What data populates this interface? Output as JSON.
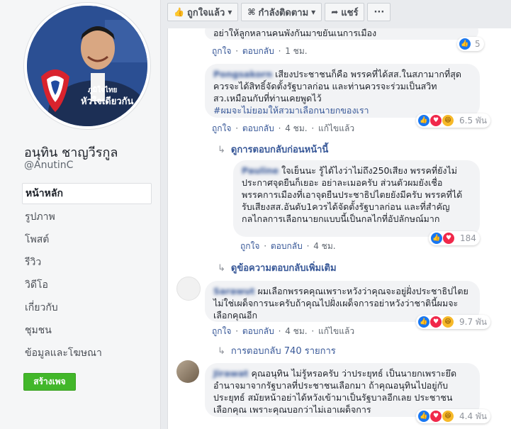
{
  "sidebar": {
    "page_name": "อนุทิน ชาญวีรกูล",
    "handle": "@AnutinC",
    "nav": [
      "หน้าหลัก",
      "รูปภาพ",
      "โพสต์",
      "รีวิว",
      "วิดีโอ",
      "เกี่ยวกับ",
      "ชุมชน",
      "ข้อมูลและโฆษณา"
    ],
    "create_page": "สร้างเพจ",
    "avatar_slogan_1": "ภูมิใจไทย",
    "avatar_slogan_2": "หัวใจเดียวกัน"
  },
  "toolbar": {
    "liked": "ถูกใจแล้ว",
    "following": "กำลังติดตาม",
    "share": "แชร์",
    "more": "···"
  },
  "comments": [
    {
      "text": "อย่าให้ลูกหลานคนพังกันมาขยันเนการเมือง",
      "like": "ถูกใจ",
      "reply": "ตอบกลับ",
      "time": "1 ชม.",
      "count": "5"
    },
    {
      "author": "Pongsakorn",
      "text": "เสียงประชาชนก็คือ พรรคที่ได้สส.ในสภามากที่สุดควรจะได้สิทธิ์จัดตั้งรัฐบาลก่อน และท่านควรจะร่วมเป็นสวิท สว.เหมือนกับที่ท่านเคยพูดไว้",
      "hashtag": "#ผมจะไม่ยอมให้สวมาเลือกนายกของเรา",
      "like": "ถูกใจ",
      "reply": "ตอบกลับ",
      "time": "4 ชม.",
      "edited": "แก้ไขแล้ว",
      "count": "6.5 พัน"
    }
  ],
  "reply_prev": "ดูการตอบกลับก่อนหน้านี้",
  "reply_comment": {
    "author": "Pauline",
    "text": "ใจเย็นนะ รู้ได้ไงว่าไม่ถึง250เสียง พรรคที่ยังไม่ประกาศจุดยืนก็เยอะ อย่าละเมอครับ ส่วนตัวผมยังเชื่อพรรคการเมืองที่เอาจุดยืนประชาธิปไตยยังมีครับ พรรคที่ได้รับเสียงสส.อันดับ1ควรได้จัดตั้งรัฐบาลก่อน และที่สำคัญ กลไกลการเลือกนายกแบบนี้เป็นกลไกที่อัปลักษณ์มาก",
    "like": "ถูกใจ",
    "reply": "ตอบกลับ",
    "time": "4 ชม.",
    "count": "184"
  },
  "more_replies": "ดูข้อความตอบกลับเพิ่มเติม",
  "comment3": {
    "author": "Sarawut",
    "text": "ผมเลือกพรรคคุณเพราะหวังว่าคุณจะอยู่ฝั่งประชาธิปไตยไม่ใช่เผด็จการนะครับถ้าคุณไปฝั่งเผด็จการอย่าหวังว่าชาตินี้ผมจะเลือกคุณอีก",
    "like": "ถูกใจ",
    "reply": "ตอบกลับ",
    "time": "4 ชม.",
    "edited": "แก้ไขแล้ว",
    "count": "9.7 พัน"
  },
  "replies_count": "การตอบกลับ 740 รายการ",
  "comment4": {
    "author": "Jirawat",
    "text": "คุณอนุทิน ไม่รู้หรอครับ ว่าประยุทธ์ เป็นนายกเพราะยึดอำนาจมาจากรัฐบาลที่ประชาชนเลือกมา ถ้าคุณอนุทินไปอยู่กับประยุทธ์ สมัยหน้าอย่าได้หวังเข้ามาเป็นรัฐบาลอีกเลย ประชาชนเลือกคุณ เพราะคุณบอกว่าไม่เอาเผด็จการ",
    "count": "4.4 พัน"
  }
}
